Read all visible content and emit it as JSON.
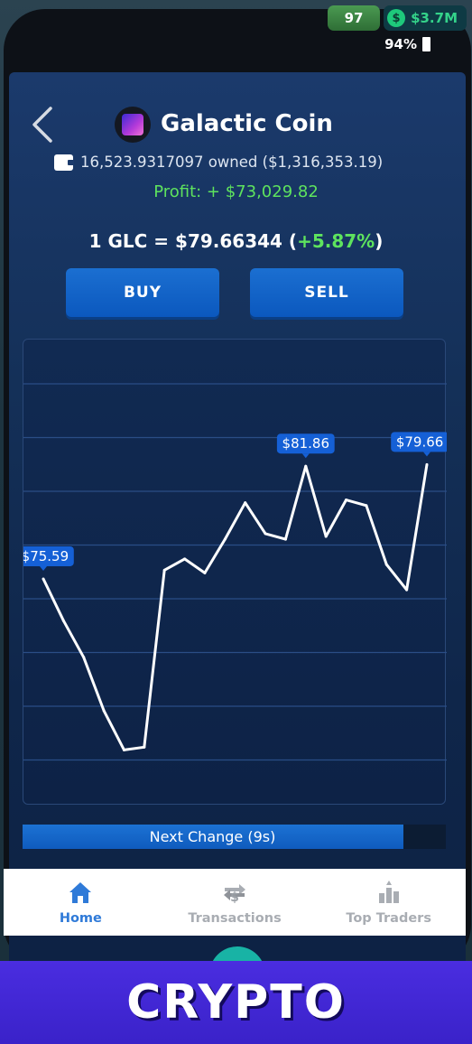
{
  "status": {
    "level": "97",
    "money": "$3.7M",
    "battery": "94%"
  },
  "coin": {
    "name": "Galactic Coin",
    "owned_text": "16,523.9317097 owned ($1,316,353.19)",
    "profit_text": "Profit: + $73,029.82",
    "price_text": "1 GLC = $79.66344 (",
    "price_change": "+5.87%",
    "price_suffix": ")"
  },
  "actions": {
    "buy_label": "BUY",
    "sell_label": "SELL"
  },
  "chart_data": {
    "type": "line",
    "values": [
      75.59,
      74.1,
      72.8,
      70.9,
      69.5,
      69.6,
      75.9,
      76.3,
      75.8,
      77.0,
      78.3,
      77.2,
      77.0,
      79.6,
      77.1,
      78.4,
      78.2,
      76.1,
      75.2,
      79.66
    ],
    "ylim": [
      69,
      82.5
    ],
    "grid": true,
    "labels": [
      {
        "index": 0,
        "text": "$75.59"
      },
      {
        "index": 13,
        "text": "$81.86"
      },
      {
        "index": 19,
        "text": "$79.66"
      }
    ]
  },
  "next_change": {
    "label": "Next Change (9s)",
    "progress": 0.9
  },
  "nav": {
    "items": [
      {
        "label": "Home",
        "icon": "home-icon"
      },
      {
        "label": "Transactions",
        "icon": "transactions-icon"
      },
      {
        "label": "Top Traders",
        "icon": "top-traders-icon"
      }
    ]
  },
  "banner": {
    "text": "CRYPTO"
  },
  "colors": {
    "accent": "#2f7ad8",
    "positive": "#5ee35e",
    "banner": "#3a22c9"
  }
}
